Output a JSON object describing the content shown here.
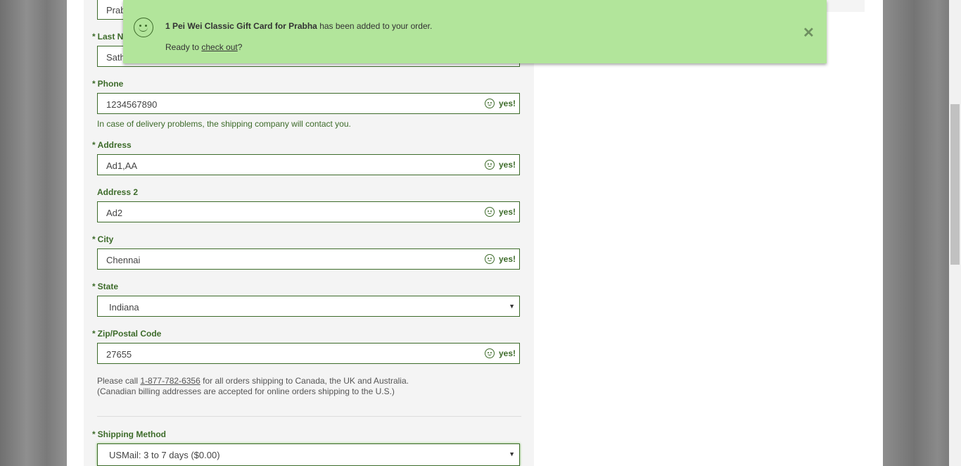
{
  "form": {
    "first_name_value": "Prab",
    "last_name_label": "Last N",
    "last_name_value": "Sath",
    "phone_label": "Phone",
    "phone_value": "1234567890",
    "phone_help": "In case of delivery problems, the shipping company will contact you.",
    "address_label": "Address",
    "address_value": "Ad1,AA",
    "address2_label": "Address 2",
    "address2_value": "Ad2",
    "city_label": "City",
    "city_value": "Chennai",
    "state_label": "State",
    "state_value": "Indiana",
    "zip_label": "Zip/Postal Code",
    "zip_value": "27655",
    "valid_text": "yes!",
    "required_mark": "*",
    "note_prefix": "Please call ",
    "note_phone": "1-877-782-6356",
    "note_suffix": " for all orders shipping to Canada, the UK and Australia.",
    "note_line2": "(Canadian billing addresses are accepted for online orders shipping to the U.S.)",
    "shipping_label": "Shipping Method",
    "shipping_value": "USMail: 3 to 7 days ($0.00)"
  },
  "toast": {
    "item": "1 Pei Wei Classic Gift Card for Prabha",
    "message": " has been added to your order.",
    "ready_prefix": "Ready to ",
    "checkout_link": "check out",
    "ready_suffix": "?",
    "close_glyph": "✕"
  },
  "icons": [
    "smile-icon",
    "close-icon",
    "caret-down-icon"
  ],
  "colors": {
    "accent_green": "#3d6b2a",
    "toast_bg": "#b2e59b",
    "form_bg": "#f4f4f4"
  }
}
